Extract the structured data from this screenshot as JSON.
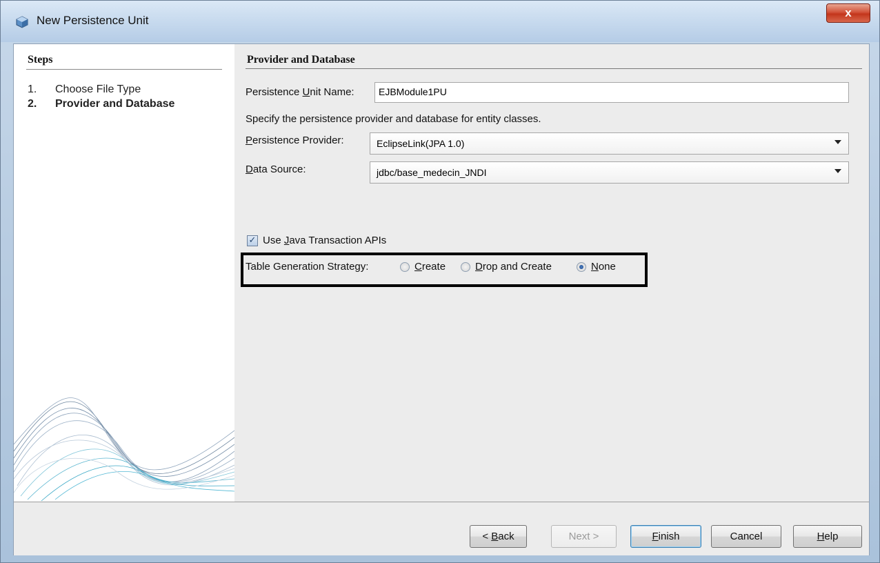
{
  "window": {
    "title": "New Persistence Unit",
    "close_label": "x"
  },
  "steps": {
    "title": "Steps",
    "items": [
      {
        "number": "1.",
        "label": "Choose File Type",
        "current": false
      },
      {
        "number": "2.",
        "label": "Provider and Database",
        "current": true
      }
    ]
  },
  "panel": {
    "title": "Provider and Database",
    "unit_name": {
      "label_pre": "Persistence ",
      "label_u": "U",
      "label_post": "nit Name:",
      "value": "EJBModule1PU"
    },
    "description": "Specify the persistence provider and database for entity classes.",
    "provider": {
      "label_pre": "",
      "label_u": "P",
      "label_post": "ersistence Provider:",
      "value": "EclipseLink(JPA 1.0)"
    },
    "datasource": {
      "label_pre": "",
      "label_u": "D",
      "label_post": "ata Source:",
      "value": "jdbc/base_medecin_JNDI"
    },
    "jta": {
      "checked": true,
      "label_pre": "Use ",
      "label_u": "J",
      "label_post": "ava Transaction APIs"
    },
    "table_generation": {
      "label": "Table Generation Strategy:",
      "options": [
        {
          "u": "C",
          "rest": "reate",
          "selected": false
        },
        {
          "u": "D",
          "rest": "rop and Create",
          "selected": false
        },
        {
          "u": "N",
          "rest": "one",
          "selected": true
        }
      ]
    }
  },
  "buttons": {
    "back_pre": "< ",
    "back_u": "B",
    "back_post": "ack",
    "next": "Next >",
    "finish_u": "F",
    "finish_post": "inish",
    "cancel": "Cancel",
    "help_u": "H",
    "help_post": "elp"
  }
}
